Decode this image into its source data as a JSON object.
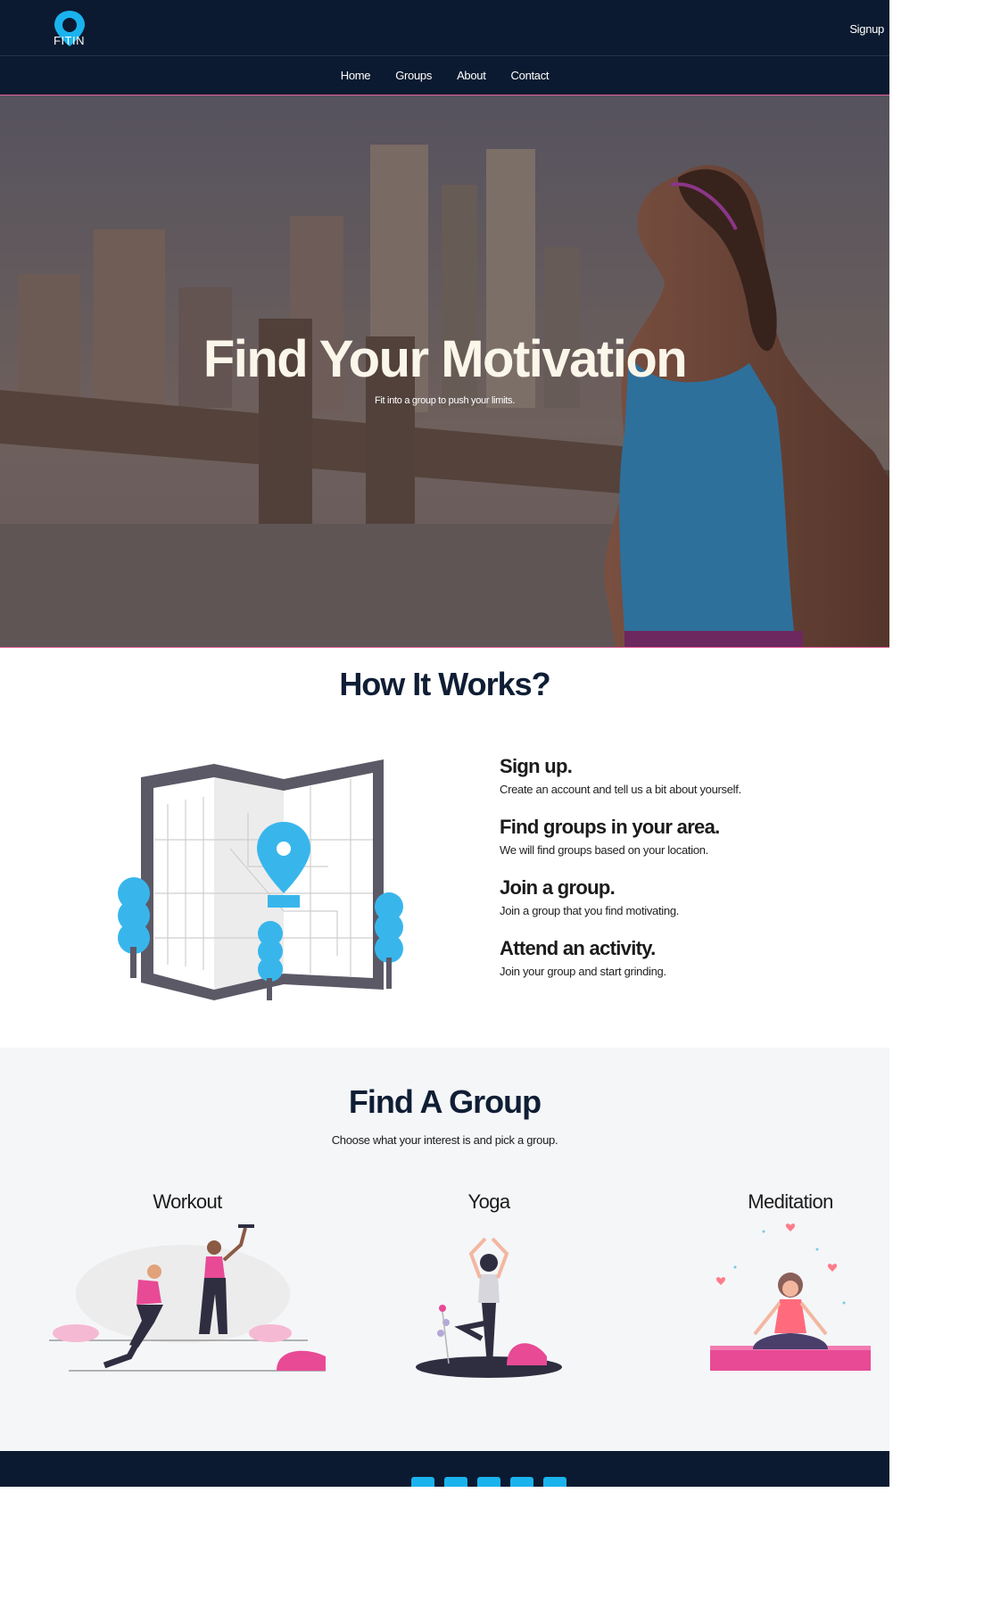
{
  "brand": {
    "logo_text": "FITIN",
    "logo_icon": "location-pin-icon"
  },
  "header": {
    "signup_label": "Signup"
  },
  "nav": {
    "items": [
      "Home",
      "Groups",
      "About",
      "Contact"
    ]
  },
  "hero": {
    "title": "Find Your Motivation",
    "subtitle": "Fit into a group to push your limits."
  },
  "how_it_works": {
    "heading": "How It Works?",
    "steps": [
      {
        "title": "Sign up.",
        "text": "Create an account and tell us a bit about yourself."
      },
      {
        "title": "Find groups in your area.",
        "text": "We will find groups based on your location."
      },
      {
        "title": "Join a group.",
        "text": "Join a group that you find motivating."
      },
      {
        "title": "Attend an activity.",
        "text": "Join your group and start grinding."
      }
    ]
  },
  "find_group": {
    "heading": "Find A Group",
    "subtitle": "Choose what your interest is and pick a group.",
    "categories": [
      "Workout",
      "Yoga",
      "Meditation"
    ]
  },
  "footer": {
    "social_icons": [
      "facebook-icon",
      "twitter-icon",
      "instagram-icon",
      "linkedin-icon",
      "github-icon"
    ]
  },
  "colors": {
    "navy": "#0b1a30",
    "accent_blue": "#1ab3ee",
    "accent_pink": "#e8609a"
  }
}
